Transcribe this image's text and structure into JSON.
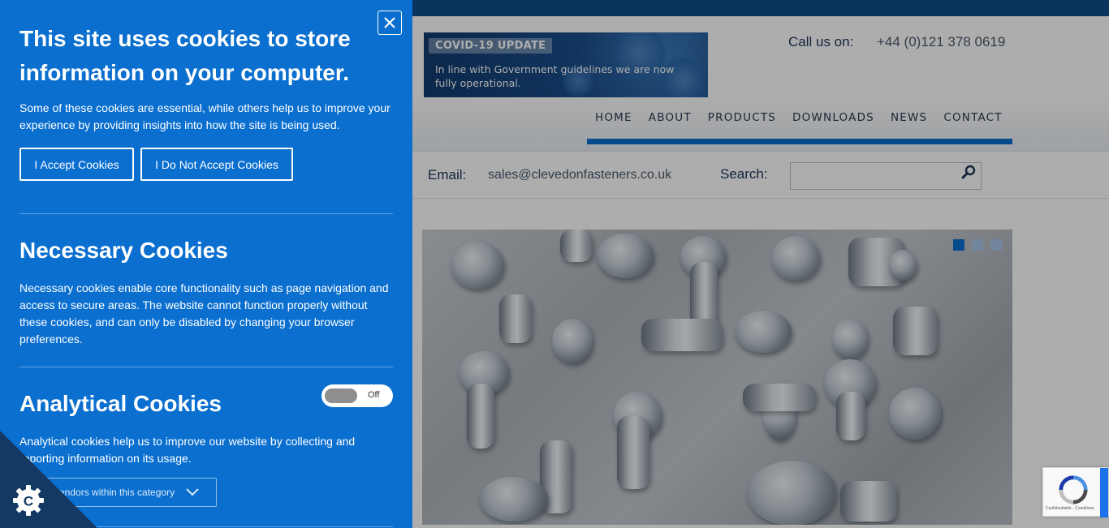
{
  "site": {
    "covid_tag": "COVID-19 UPDATE",
    "covid_text": "In line with Government guidelines we are now fully operational.",
    "call_label": "Call us on:",
    "phone": "+44 (0)121 378 0619",
    "nav": [
      "HOME",
      "ABOUT",
      "PRODUCTS",
      "DOWNLOADS",
      "NEWS",
      "CONTACT"
    ],
    "email_label": "Email:",
    "email": "sales@clevedonfasteners.co.uk",
    "search_label": "Search:",
    "search_value": "",
    "slider_dots": 3,
    "slider_active": 1,
    "recaptcha_text": "Confidentialité - Conditions"
  },
  "cookie_panel": {
    "title": "This site uses cookies to store information on your computer.",
    "intro": "Some of these cookies are essential, while others help us to improve your experience by providing insights into how the site is being used.",
    "accept_label": "I Accept Cookies",
    "reject_label": "I Do Not Accept Cookies",
    "necessary": {
      "heading": "Necessary Cookies",
      "text": "Necessary cookies enable core functionality such as page navigation and access to secure areas. The website cannot function properly without these cookies, and can only be disabled by changing your browser preferences."
    },
    "analytical": {
      "heading": "Analytical Cookies",
      "toggle_label": "Off",
      "text": "Analytical cookies help us to improve our website by collecting and reporting information on its usage.",
      "vendors_label": "vendors within this category"
    }
  },
  "colors": {
    "panel_blue": "#0a6fcf",
    "top_bar": "#0f4d8a",
    "corner_dark": "#143a63"
  }
}
